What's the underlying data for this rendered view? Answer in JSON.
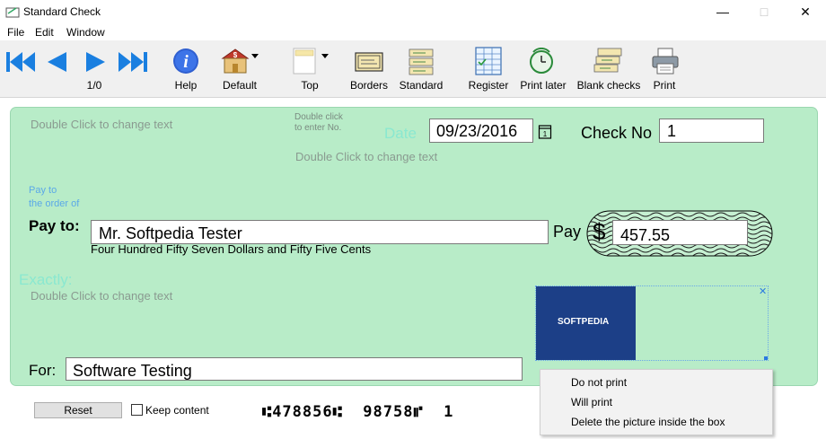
{
  "window": {
    "title": "Standard Check",
    "minimize": "—",
    "maximize": "□",
    "close": "✕"
  },
  "menu": [
    "File",
    "Edit",
    "Window"
  ],
  "toolbar": {
    "counter": "1/0",
    "buttons": {
      "help": "Help",
      "default": "Default",
      "top": "Top",
      "borders": "Borders",
      "standard": "Standard",
      "register": "Register",
      "print_later": "Print later",
      "blank_checks": "Blank checks",
      "print": "Print"
    }
  },
  "check": {
    "hint_top_left": "Double Click to change text",
    "hint_enter_no": "Double click\nto enter No.",
    "date_label": "Date",
    "date_value": "09/23/2016",
    "check_no_label": "Check No",
    "check_no_value": "1",
    "hint_under_date": "Double Click to change text",
    "pay_to_order_hint": "Pay to\nthe order of",
    "pay_to_label": "Pay to:",
    "payee": "Mr. Softpedia Tester",
    "amount_words": "Four Hundred Fifty Seven Dollars and Fifty Five Cents",
    "pay_label": "Pay",
    "dollar_sign": "$",
    "amount": "457.55",
    "exactly_label": "Exactly:",
    "hint_middle": "Double Click to change text",
    "logo_text": "SOFTPEDIA",
    "logo_close": "✕",
    "for_label": "For:",
    "memo": "Software Testing"
  },
  "bottom": {
    "reset": "Reset",
    "keep_content": "Keep content",
    "micr": "⑆478856⑆  98758⑈  1"
  },
  "context_menu": [
    "Do not print",
    "Will print",
    "Delete the picture inside the box"
  ],
  "colors": {
    "check_bg": "#b8ecc8",
    "nav_blue": "#1a7fe0",
    "logo_bg": "#1c3f87"
  }
}
